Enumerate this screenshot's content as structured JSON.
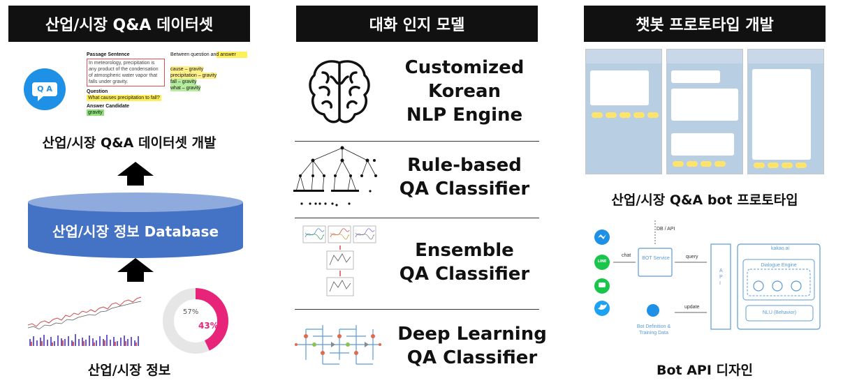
{
  "headers": {
    "left": "산업/시장 Q&A 데이터셋",
    "center": "대화 인지 모델",
    "right": "챗봇 프로토타입 개발"
  },
  "left": {
    "qa_box": {
      "passage_label": "Passage Sentence",
      "passage_text": "In meteorology, precipitation is any product of the condensation of atmospheric water vapor that falls under gravity.",
      "question_label": "Question",
      "question_text": "What causes precipitation to fall?",
      "answer_label": "Answer Candidate",
      "answer_text": "gravity",
      "bullet": "Between question and answer",
      "pairs": [
        "cause – gravity",
        "precipitation – gravity",
        "fall – gravity",
        "what – gravity"
      ]
    },
    "qa_icon_text": "Q A",
    "dataset_caption": "산업/시장 Q&A 데이터셋 개발",
    "database_label": "산업/시장 정보 Database",
    "info_caption": "산업/시장 정보",
    "donut": {
      "outer_label": "57%",
      "inner_label": "43%",
      "highlight_fraction": 0.43
    }
  },
  "center": {
    "models": [
      {
        "line1": "Customized",
        "line2": "Korean",
        "line3": "NLP Engine"
      },
      {
        "line1": "Rule-based",
        "line2": "QA Classifier"
      },
      {
        "line1": "Ensemble",
        "line2": "QA Classifier"
      },
      {
        "line1": "Deep Learning",
        "line2": "QA Classifier"
      }
    ]
  },
  "right": {
    "prototype_caption": "산업/시장 Q&A bot 프로토타입",
    "api_caption": "Bot API 디자인",
    "arch": {
      "db_api": "DB / API",
      "chat": "chat",
      "bot_service": "BOT Service",
      "query": "query",
      "update": "update",
      "api": "A P I",
      "kakao": "kakao.ai",
      "dialogue_engine": "Dialogue Engine",
      "nlu": "NLU (Behavior)",
      "bot_definition": "Bot Definition & Training Data",
      "line_label": "LINE"
    }
  },
  "colors": {
    "db_blue": "#4472c4",
    "db_top": "#8faadc",
    "donut_pink": "#e8247a",
    "messenger": "#1e90e6",
    "line_green": "#19c64b",
    "twitter": "#1da1f2",
    "arch_blue": "#5b9bd5"
  }
}
